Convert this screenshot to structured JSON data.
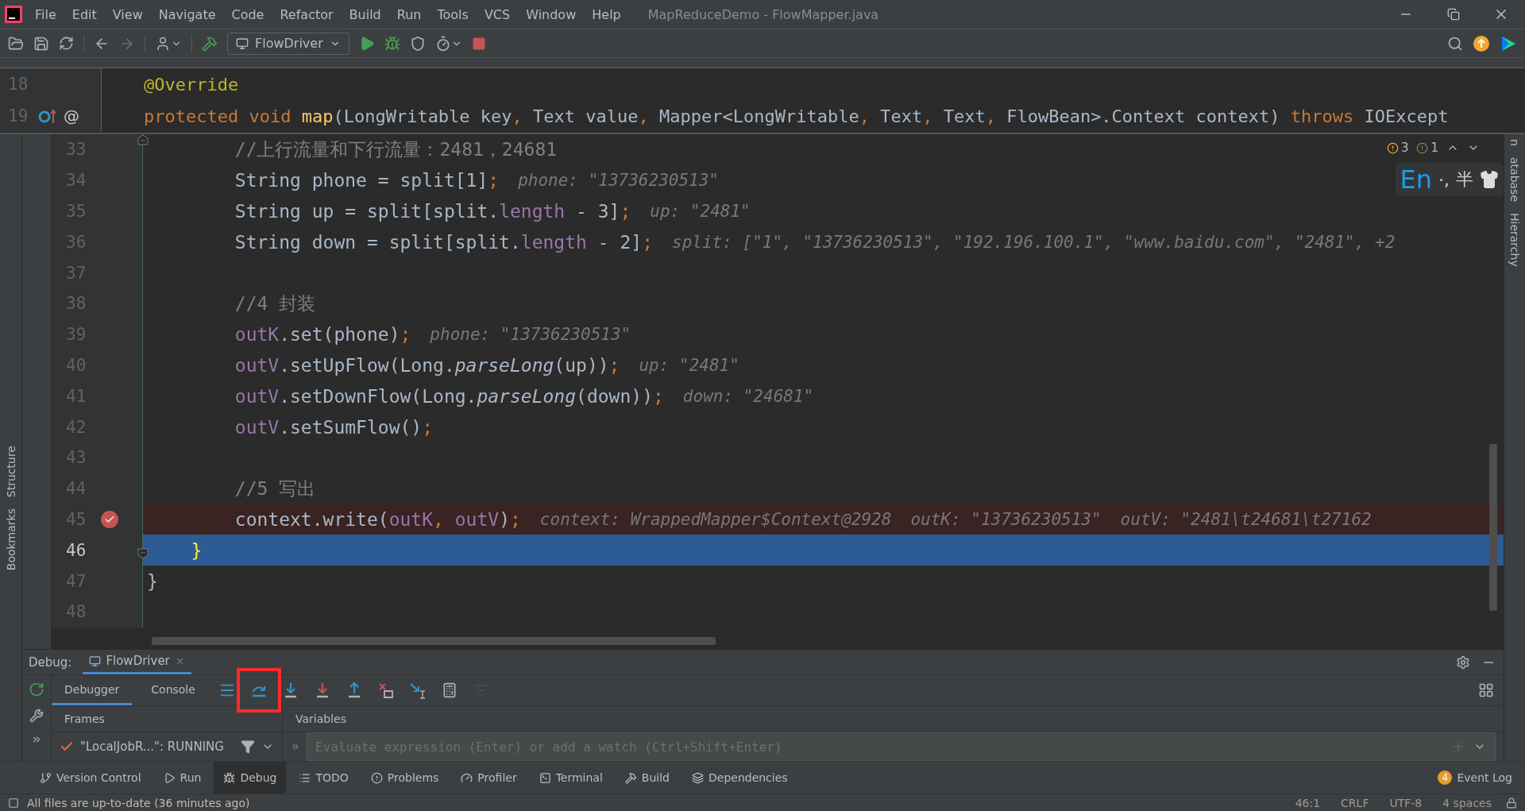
{
  "window": {
    "title": "MapReduceDemo - FlowMapper.java"
  },
  "menu": [
    "File",
    "Edit",
    "View",
    "Navigate",
    "Code",
    "Refactor",
    "Build",
    "Run",
    "Tools",
    "VCS",
    "Window",
    "Help"
  ],
  "toolbar": {
    "run_config": "FlowDriver"
  },
  "sticky_lines": [
    {
      "number": "18",
      "tokens": [
        {
          "kind": "annotation",
          "text": "    @Override"
        }
      ]
    },
    {
      "number": "19",
      "marker": "@",
      "tokens": [
        {
          "kind": "keyword",
          "text": "    protected void "
        },
        {
          "kind": "method",
          "text": "map"
        },
        {
          "kind": "plain",
          "text": "(LongWritable key"
        },
        {
          "kind": "punct",
          "text": ","
        },
        {
          "kind": "plain",
          "text": " Text value"
        },
        {
          "kind": "punct",
          "text": ","
        },
        {
          "kind": "plain",
          "text": " Mapper<LongWritable"
        },
        {
          "kind": "punct",
          "text": ","
        },
        {
          "kind": "plain",
          "text": " Text"
        },
        {
          "kind": "punct",
          "text": ","
        },
        {
          "kind": "plain",
          "text": " Text"
        },
        {
          "kind": "punct",
          "text": ","
        },
        {
          "kind": "plain",
          "text": " FlowBean>.Context context) "
        },
        {
          "kind": "keyword",
          "text": "throws"
        },
        {
          "kind": "plain",
          "text": " IOExcept"
        }
      ]
    }
  ],
  "inspections": {
    "warnings": "3",
    "weak_warnings": "1"
  },
  "ime": {
    "mode": "En",
    "punctuation": "·,",
    "width": "半"
  },
  "code_lines": [
    {
      "number": "33",
      "breakpoint": false,
      "current": false,
      "fold_start": true,
      "tokens": [
        {
          "kind": "comment",
          "text": "        //上行流量和下行流量：2481，24681"
        }
      ]
    },
    {
      "number": "34",
      "breakpoint": false,
      "current": false,
      "tokens": [
        {
          "kind": "plain",
          "text": "        String phone = split[1]"
        },
        {
          "kind": "punct",
          "text": ";"
        }
      ],
      "hints": [
        "phone: \"13736230513\""
      ]
    },
    {
      "number": "35",
      "breakpoint": false,
      "current": false,
      "tokens": [
        {
          "kind": "plain",
          "text": "        String up = split[split."
        },
        {
          "kind": "field",
          "text": "length"
        },
        {
          "kind": "plain",
          "text": " - 3]"
        },
        {
          "kind": "punct",
          "text": ";"
        }
      ],
      "hints": [
        "up: \"2481\""
      ]
    },
    {
      "number": "36",
      "breakpoint": false,
      "current": false,
      "tokens": [
        {
          "kind": "plain",
          "text": "        String down = split[split."
        },
        {
          "kind": "field",
          "text": "length"
        },
        {
          "kind": "plain",
          "text": " - 2]"
        },
        {
          "kind": "punct",
          "text": ";"
        }
      ],
      "hints": [
        "split: [\"1\", \"13736230513\", \"192.196.100.1\", \"www.baidu.com\", \"2481\", +2"
      ]
    },
    {
      "number": "37",
      "breakpoint": false,
      "current": false
    },
    {
      "number": "38",
      "breakpoint": false,
      "current": false,
      "tokens": [
        {
          "kind": "comment",
          "text": "        //4 封装"
        }
      ]
    },
    {
      "number": "39",
      "breakpoint": false,
      "current": false,
      "tokens": [
        {
          "kind": "field",
          "text": "        outK"
        },
        {
          "kind": "plain",
          "text": ".set(phone)"
        },
        {
          "kind": "punct",
          "text": ";"
        }
      ],
      "hints": [
        "phone: \"13736230513\""
      ]
    },
    {
      "number": "40",
      "breakpoint": false,
      "current": false,
      "tokens": [
        {
          "kind": "field",
          "text": "        outV"
        },
        {
          "kind": "plain",
          "text": ".setUpFlow(Long."
        },
        {
          "kind": "static",
          "text": "parseLong"
        },
        {
          "kind": "plain",
          "text": "(up))"
        },
        {
          "kind": "punct",
          "text": ";"
        }
      ],
      "hints": [
        "up: \"2481\""
      ]
    },
    {
      "number": "41",
      "breakpoint": false,
      "current": false,
      "tokens": [
        {
          "kind": "field",
          "text": "        outV"
        },
        {
          "kind": "plain",
          "text": ".setDownFlow(Long."
        },
        {
          "kind": "static",
          "text": "parseLong"
        },
        {
          "kind": "plain",
          "text": "(down))"
        },
        {
          "kind": "punct",
          "text": ";"
        }
      ],
      "hints": [
        "down: \"24681\""
      ]
    },
    {
      "number": "42",
      "breakpoint": false,
      "current": false,
      "tokens": [
        {
          "kind": "field",
          "text": "        outV"
        },
        {
          "kind": "plain",
          "text": ".setSumFlow()"
        },
        {
          "kind": "punct",
          "text": ";"
        }
      ]
    },
    {
      "number": "43",
      "breakpoint": false,
      "current": false
    },
    {
      "number": "44",
      "breakpoint": false,
      "current": false,
      "tokens": [
        {
          "kind": "comment",
          "text": "        //5 写出"
        }
      ]
    },
    {
      "number": "45",
      "breakpoint": true,
      "current": false,
      "tokens": [
        {
          "kind": "plain",
          "text": "        context.write("
        },
        {
          "kind": "field",
          "text": "outK"
        },
        {
          "kind": "punct",
          "text": ", "
        },
        {
          "kind": "field",
          "text": "outV"
        },
        {
          "kind": "plain",
          "text": ")"
        },
        {
          "kind": "punct",
          "text": ";"
        }
      ],
      "hints": [
        "context: WrappedMapper$Context@2928",
        "outK: \"13736230513\"",
        "outV: \"2481\\t24681\\t27162"
      ]
    },
    {
      "number": "46",
      "breakpoint": false,
      "current": true,
      "fold_end": true,
      "tokens": [
        {
          "kind": "brace",
          "text": "    }"
        }
      ]
    },
    {
      "number": "47",
      "breakpoint": false,
      "current": false,
      "tokens": [
        {
          "kind": "plain",
          "text": "}"
        }
      ]
    },
    {
      "number": "48",
      "breakpoint": false,
      "current": false
    }
  ],
  "side_tabs": {
    "left": [
      "Structure",
      "Bookmarks"
    ],
    "right": [
      "n",
      "atabase",
      "Hierarchy"
    ]
  },
  "debug": {
    "label": "Debug:",
    "session": "FlowDriver",
    "tabs": [
      {
        "label": "Debugger",
        "selected": true
      },
      {
        "label": "Console",
        "selected": false
      }
    ],
    "actions": [
      {
        "kind": "frames",
        "highlighted": false,
        "disabled": false
      },
      {
        "kind": "step-over",
        "highlighted": true,
        "disabled": false
      },
      {
        "kind": "step-into",
        "highlighted": false,
        "disabled": false
      },
      {
        "kind": "force-step-into",
        "highlighted": false,
        "disabled": false
      },
      {
        "kind": "step-out",
        "highlighted": false,
        "disabled": false
      },
      {
        "kind": "drop-frame",
        "highlighted": false,
        "disabled": false
      },
      {
        "kind": "run-to-cursor",
        "highlighted": false,
        "disabled": false
      },
      {
        "kind": "evaluate",
        "highlighted": false,
        "disabled": false
      },
      {
        "kind": "trace",
        "highlighted": false,
        "disabled": true
      }
    ],
    "frames_title": "Frames",
    "variables_title": "Variables",
    "thread": "\"LocalJobR...\": RUNNING",
    "watch": {
      "placeholder": "Evaluate expression (Enter) or add a watch (Ctrl+Shift+Enter)"
    }
  },
  "tool_windows": [
    {
      "kind": "vcs",
      "label": "Version Control",
      "selected": false
    },
    {
      "kind": "run",
      "label": "Run",
      "selected": false
    },
    {
      "kind": "debug",
      "label": "Debug",
      "selected": true
    },
    {
      "kind": "todo",
      "label": "TODO",
      "selected": false
    },
    {
      "kind": "problems",
      "label": "Problems",
      "selected": false
    },
    {
      "kind": "profiler",
      "label": "Profiler",
      "selected": false
    },
    {
      "kind": "terminal",
      "label": "Terminal",
      "selected": false
    },
    {
      "kind": "build",
      "label": "Build",
      "selected": false
    },
    {
      "kind": "dependencies",
      "label": "Dependencies",
      "selected": false
    }
  ],
  "event_log": {
    "count": "4",
    "label": "Event Log"
  },
  "status_bar": {
    "message": "All files are up-to-date (36 minutes ago)",
    "position": "46:1",
    "line_separator": "CRLF",
    "encoding": "UTF-8",
    "indent": "4 spaces"
  }
}
